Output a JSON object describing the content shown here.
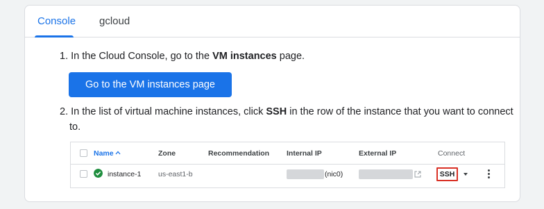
{
  "tabs": [
    {
      "label": "Console",
      "active": true
    },
    {
      "label": "gcloud",
      "active": false
    }
  ],
  "step1": {
    "number": "1.",
    "prefix": "In the Cloud Console, go to the ",
    "bold": "VM instances",
    "suffix": " page."
  },
  "go_button": {
    "label": "Go to the VM instances page"
  },
  "step2": {
    "number": "2.",
    "prefix": "In the list of virtual machine instances, click ",
    "bold": "SSH",
    "suffix_line1": " in the row of the instance that you want to connect",
    "suffix_line2": "to."
  },
  "table": {
    "headers": {
      "name": "Name",
      "zone": "Zone",
      "recommendation": "Recommendation",
      "internal_ip": "Internal IP",
      "external_ip": "External IP",
      "connect": "Connect"
    },
    "row": {
      "name": "instance-1",
      "zone": "us-east1-b",
      "recommendation": "",
      "internal_ip_suffix": "(nic0)",
      "connect_label": "SSH",
      "status": "running"
    }
  },
  "colors": {
    "accent": "#1a73e8",
    "status_ok": "#1e8e3e",
    "highlight_box": "#d93025"
  },
  "icons": [
    "check-circle-icon",
    "sort-up-icon",
    "external-link-icon",
    "caret-down-icon",
    "more-vert-icon"
  ]
}
